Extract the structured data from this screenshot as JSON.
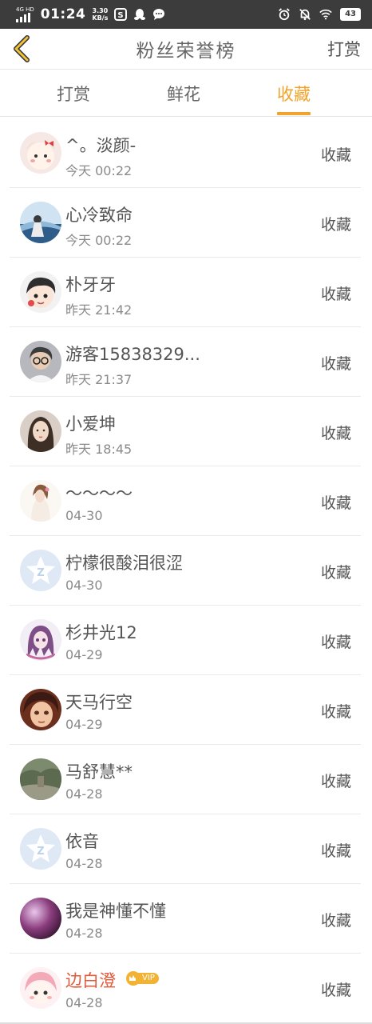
{
  "status_bar": {
    "network": "4G HD",
    "time": "01:24",
    "speed_value": "3.30",
    "speed_unit": "KB/s",
    "battery": "43",
    "icons": [
      "signal-icon",
      "sim-app-icon",
      "qq-penguin-icon",
      "chat-bubble-icon",
      "alarm-icon",
      "mute-icon",
      "wifi-icon",
      "battery-icon"
    ]
  },
  "header": {
    "back_icon": "chevron-left-icon",
    "title": "粉丝荣誉榜",
    "right_action": "打赏"
  },
  "tabs": [
    {
      "label": "打赏",
      "active": false
    },
    {
      "label": "鲜花",
      "active": false
    },
    {
      "label": "收藏",
      "active": true
    }
  ],
  "accent_color": "#f1a32b",
  "fans": [
    {
      "name": "^。淡颜-",
      "time": "今天 00:22",
      "action": "收藏",
      "avatar": "cartoon-girl-avatar"
    },
    {
      "name": "心冷致命",
      "time": "今天 00:22",
      "action": "收藏",
      "avatar": "photo-avatar"
    },
    {
      "name": "朴牙牙",
      "time": "昨天 21:42",
      "action": "收藏",
      "avatar": "cartoon-boy-avatar"
    },
    {
      "name": "游客15838329...",
      "time": "昨天 21:37",
      "action": "收藏",
      "avatar": "photo-avatar"
    },
    {
      "name": "小爱坤",
      "time": "昨天 18:45",
      "action": "收藏",
      "avatar": "photo-avatar"
    },
    {
      "name": "～～～～",
      "time": "04-30",
      "action": "收藏",
      "avatar": "photo-avatar"
    },
    {
      "name": "柠檬很酸泪很涩",
      "time": "04-30",
      "action": "收藏",
      "avatar": "default-star-avatar"
    },
    {
      "name": "杉井光12",
      "time": "04-29",
      "action": "收藏",
      "avatar": "anime-avatar"
    },
    {
      "name": "天马行空",
      "time": "04-29",
      "action": "收藏",
      "avatar": "anime-avatar"
    },
    {
      "name": "马舒慧**",
      "time": "04-28",
      "action": "收藏",
      "avatar": "landscape-avatar"
    },
    {
      "name": "依音",
      "time": "04-28",
      "action": "收藏",
      "avatar": "default-star-avatar"
    },
    {
      "name": "我是神懂不懂",
      "time": "04-28",
      "action": "收藏",
      "avatar": "photo-avatar"
    },
    {
      "name": "边白澄",
      "time": "04-28",
      "action": "收藏",
      "avatar": "cartoon-girl-avatar",
      "vip": "VIP"
    }
  ]
}
